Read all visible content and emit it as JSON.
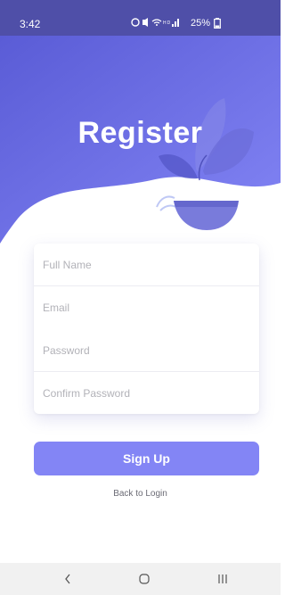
{
  "status_bar": {
    "time": "3:42",
    "battery": "25%"
  },
  "header": {
    "title": "Register"
  },
  "form": {
    "full_name_placeholder": "Full Name",
    "email_placeholder": "Email",
    "password_placeholder": "Password",
    "confirm_password_placeholder": "Confirm Password"
  },
  "actions": {
    "signup_label": "Sign Up",
    "back_link_label": "Back to Login"
  },
  "icons": {
    "status_bar": [
      "alarm-icon",
      "mute-icon",
      "wifi-icon",
      "hd-icon",
      "signal-icon",
      "battery-icon"
    ],
    "nav_bar": [
      "back-icon",
      "home-icon",
      "recents-icon"
    ]
  },
  "colors": {
    "header_gradient_start": "#5a5cd6",
    "header_gradient_end": "#8385f5",
    "button": "#8385f5"
  }
}
